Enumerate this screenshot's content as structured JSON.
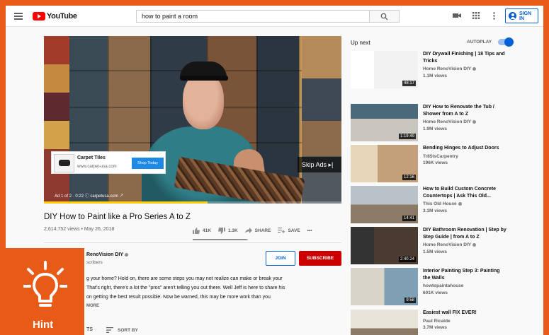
{
  "header": {
    "logo_text": "YouTube",
    "search_value": "how to paint a room",
    "signin_label": "SIGN IN"
  },
  "player": {
    "ad_title": "Carpet Tiles",
    "ad_url": "www.carpet-usa.com",
    "ad_button": "Shop Today",
    "skip_label": "Skip Ads ▸|",
    "ad_info": "Ad 1 of 2 · 0:22 ⓘ carpetusa.com ↗",
    "progress": 0.55
  },
  "video": {
    "title": "DIY How to Paint like a Pro Series A to Z",
    "views_date": "2,614,752 views • May 26, 2018",
    "likes": "41K",
    "dislikes": "1.3K",
    "share_label": "SHARE",
    "save_label": "SAVE",
    "more_label": "•••"
  },
  "channel": {
    "name": "RenoVision DIY",
    "subscribers": "scribers",
    "join_label": "JOIN",
    "subscribe_label": "SUBSCRIBE"
  },
  "description": {
    "lines": [
      "g your home? Hold on, there are some steps you may not realize can make or break your",
      "That's right, there's a lot the \"pros\" aren't telling you out there. Well Jeff is here to share his",
      "on getting the best result possible. Now be warned, this may be more work than you"
    ],
    "show_more": "MORE"
  },
  "comments": {
    "count_label": "TS",
    "sort_label": "SORT BY"
  },
  "hint": {
    "label": "Hint",
    "color": "#e85a17"
  },
  "sidebar": {
    "upnext_label": "Up next",
    "autoplay_label": "AUTOPLAY",
    "autoplay_on": true,
    "items": [
      {
        "title": "DIY Drywall Finishing | 18 Tips and Tricks",
        "channel": "Home RenoVision DIY",
        "views": "1.1M views",
        "duration": "48:17",
        "verified": true
      },
      {
        "title": "DIY How to Renovate the Tub / Shower from A to Z",
        "channel": "Home RenoVision DIY",
        "views": "1.9M views",
        "duration": "1:19:49",
        "verified": true
      },
      {
        "title": "Bending Hinges to Adjust Doors",
        "channel": "Tr85tsCarpentry",
        "views": "196K views",
        "duration": "12:16",
        "verified": false
      },
      {
        "title": "How to Build Custom Concrete Countertops | Ask This Old...",
        "channel": "This Old House",
        "views": "3.1M views",
        "duration": "14:41",
        "verified": true
      },
      {
        "title": "DIY Bathroom Renovation | Step by Step Guide | from A to Z",
        "channel": "Home RenoVision DIY",
        "views": "1.5M views",
        "duration": "2:40:24",
        "verified": true
      },
      {
        "title": "Interior Painting Step 3: Painting the Walls",
        "channel": "howtopaintahouse",
        "views": "601K views",
        "duration": "9:58",
        "verified": false
      },
      {
        "title": "Easiest wall FIX EVER!",
        "channel": "Paul Ricalde",
        "views": "3.7M views",
        "duration": "",
        "verified": false
      }
    ]
  },
  "colors": {
    "accent_blue": "#065fd4",
    "subscribe_red": "#cc0000",
    "ad_progress": "#ffcc00"
  }
}
